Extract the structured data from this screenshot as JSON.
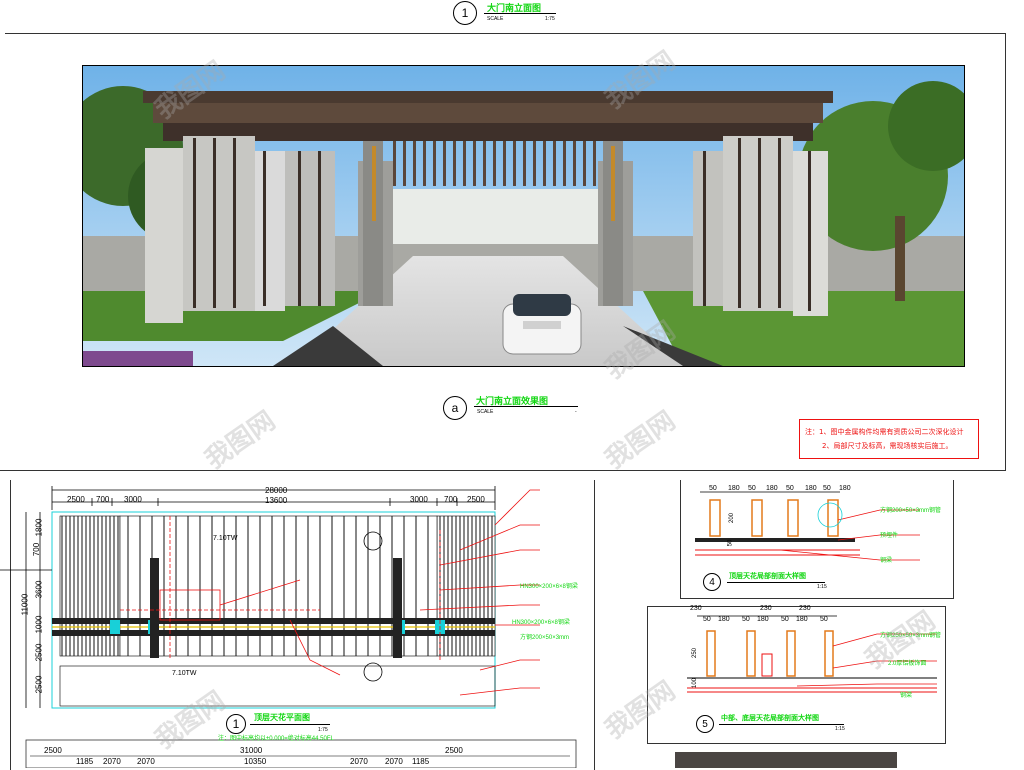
{
  "top_view": {
    "number": "1",
    "title": "大门南立面图",
    "scale_label": "SCALE",
    "scale_value": "1:75"
  },
  "perspective_view": {
    "number": "a",
    "title": "大门南立面效果图",
    "scale_label": "SCALE",
    "scale_value": "-"
  },
  "note": {
    "line1": "注：1、图中金属构件均需有资质公司二次深化设计",
    "line2": "2、局部尺寸及标高，需现场核实后施工。"
  },
  "plan_view": {
    "number": "1",
    "title": "顶层天花平面图",
    "scale_label": "SCALE",
    "scale_value": "1:75",
    "subnote": "注：图中标高均以±0.000=绝对标高44.50FL",
    "top_dims": [
      "2500",
      "700",
      "3000",
      "28000",
      "13600",
      "3000",
      "700",
      "2500"
    ],
    "left_dims": [
      "11000",
      "1800",
      "700",
      "3600",
      "2500",
      "2500",
      "1000"
    ],
    "elev_labels": [
      "7.10TW",
      "7.10TW"
    ],
    "steel_labels": [
      "HN300×200×6×8钢梁",
      "HN300×200×6×8钢梁",
      "方钢200×50×3mm"
    ],
    "bottom_dims": [
      "2500",
      "1185",
      "2070",
      "2070",
      "10350",
      "2070",
      "2070",
      "1185",
      "2500",
      "31000"
    ]
  },
  "detail_4": {
    "number": "4",
    "title": "顶层天花局部剖面大样图",
    "scale_value": "1:15",
    "dims": [
      "50",
      "180",
      "50",
      "180",
      "50",
      "180",
      "50",
      "180",
      "50",
      "200"
    ],
    "callouts": [
      "方钢200×50×3mm钢管",
      "预埋件",
      "钢梁"
    ]
  },
  "detail_5": {
    "number": "5",
    "title": "中部、底层天花局部剖面大样图",
    "scale_value": "1:15",
    "dims": [
      "230",
      "230",
      "230",
      "50",
      "180",
      "50",
      "180",
      "50",
      "180",
      "50",
      "250",
      "100"
    ],
    "callouts": [
      "方钢250×50×3mm钢管",
      "2.0厚铝板饰面",
      "钢梁"
    ]
  },
  "watermarks": [
    "我图网",
    "我图网",
    "我图网",
    "我图网",
    "我图网",
    "我图网",
    "我图网",
    "我图网"
  ]
}
